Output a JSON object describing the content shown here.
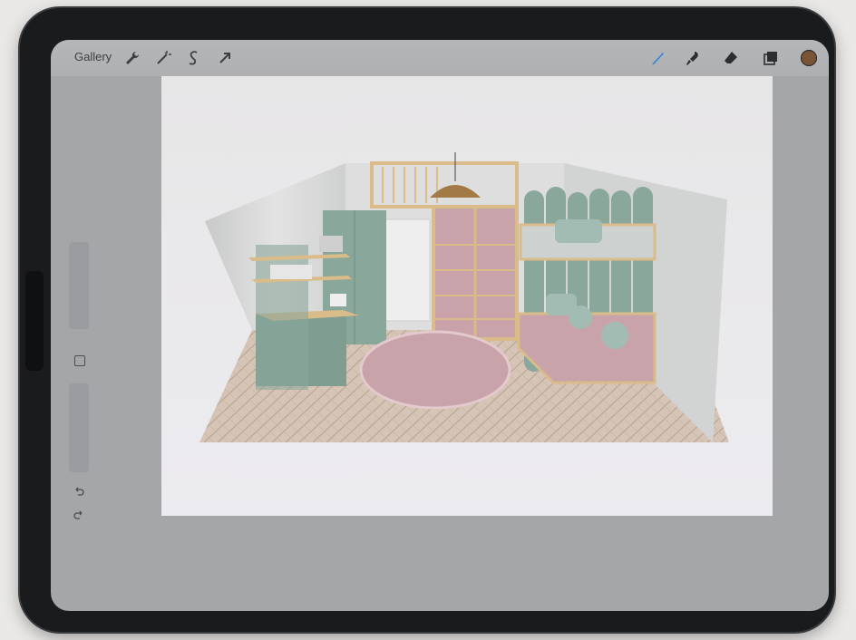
{
  "toolbar": {
    "gallery_label": "Gallery",
    "left_tools": [
      "wrench-icon",
      "magic-wand-icon",
      "selection-icon",
      "transform-arrow-icon"
    ],
    "right_tools": [
      "brush-icon",
      "smudge-icon",
      "eraser-icon",
      "layers-icon",
      "color-swatch"
    ],
    "active_color": "#7a5535",
    "active_tool_color": "#2f7fd8"
  },
  "sidebar": {
    "items": [
      "brush-size-slider",
      "modify-button",
      "brush-opacity-slider",
      "undo-icon",
      "redo-icon"
    ]
  },
  "canvas": {
    "description_colors": {
      "wall": "#dcdcdc",
      "sage": "#8aa79b",
      "pink": "#c9a3aa",
      "wood": "#d9bc8a"
    }
  }
}
